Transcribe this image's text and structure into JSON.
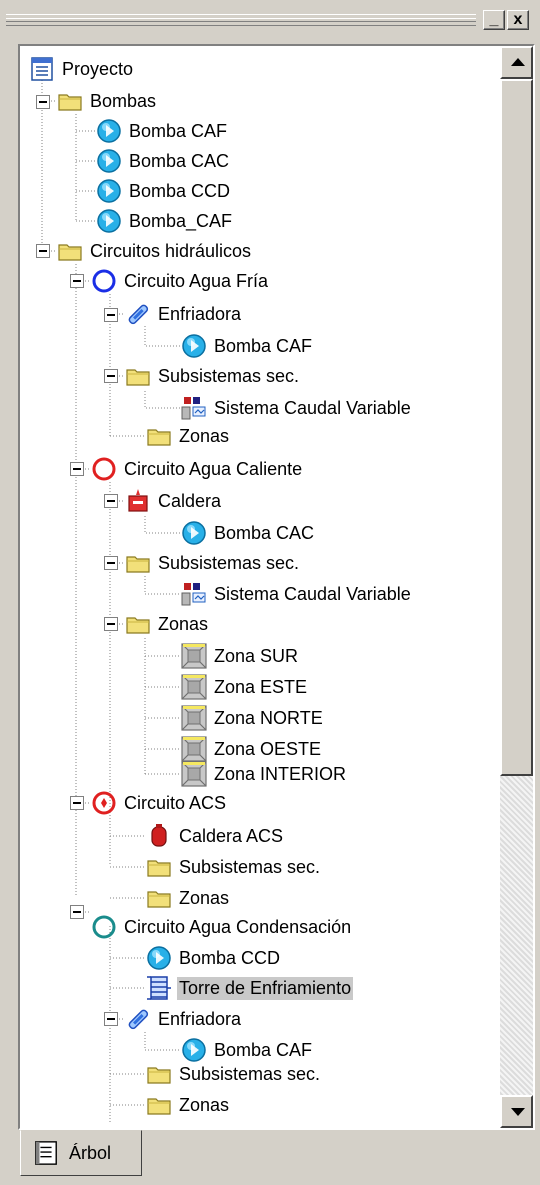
{
  "panel": {
    "title_buttons": {
      "minimize": "_",
      "close": "x"
    },
    "tab_label": "Árbol"
  },
  "tree": {
    "proyecto": "Proyecto",
    "bombas": "Bombas",
    "bomba_caf_1": "Bomba CAF",
    "bomba_cac_1": "Bomba CAC",
    "bomba_ccd_1": "Bomba CCD",
    "bomba_caf_2": "Bomba_CAF",
    "circuitos": "Circuitos hidráulicos",
    "c1": "Circuito Agua Fría",
    "c1_enfriadora": "Enfriadora",
    "c1_bomba": "Bomba CAF",
    "c1_subsistemas": "Subsistemas sec.",
    "c1_scv": "Sistema Caudal Variable",
    "c1_zonas": "Zonas",
    "c2": "Circuito Agua Caliente",
    "c2_caldera": "Caldera",
    "c2_bomba": "Bomba CAC",
    "c2_subsistemas": "Subsistemas sec.",
    "c2_scv": "Sistema Caudal Variable",
    "c2_zonas": "Zonas",
    "zona_sur": "Zona SUR",
    "zona_este": "Zona ESTE",
    "zona_norte": "Zona NORTE",
    "zona_oeste": "Zona OESTE",
    "zona_interior": "Zona INTERIOR",
    "c3": "Circuito ACS",
    "c3_caldera": "Caldera ACS",
    "c3_subsistemas": "Subsistemas sec.",
    "c3_zonas": "Zonas",
    "c4": "Circuito Agua Condensación",
    "c4_bomba": "Bomba CCD",
    "c4_torre": "Torre de Enfriamiento",
    "c4_enfriadora": "Enfriadora",
    "c4_bomba_caf": "Bomba CAF",
    "c4_subsistemas": "Subsistemas sec.",
    "c4_zonas": "Zonas"
  },
  "icons": {
    "pump": "pump-icon",
    "folder": "folder-icon",
    "circuit_cold": "circuit-cold-icon",
    "circuit_hot": "circuit-hot-icon",
    "circuit_acs": "circuit-acs-icon",
    "circuit_cond": "circuit-condensation-icon",
    "chiller": "chiller-icon",
    "boiler": "boiler-icon",
    "zone": "zone-icon",
    "tower": "cooling-tower-icon",
    "variable_flow": "variable-flow-system-icon",
    "project": "project-icon",
    "tree_tab": "tree-tab-icon"
  },
  "colors": {
    "circuit_cold": "#1a2ee6",
    "circuit_hot": "#e02020",
    "circuit_cond": "#1a8c8c",
    "pump": "#28b0e8",
    "folder": "#f2e07a",
    "boiler": "#e03030",
    "selection": "#c9c9c9"
  }
}
